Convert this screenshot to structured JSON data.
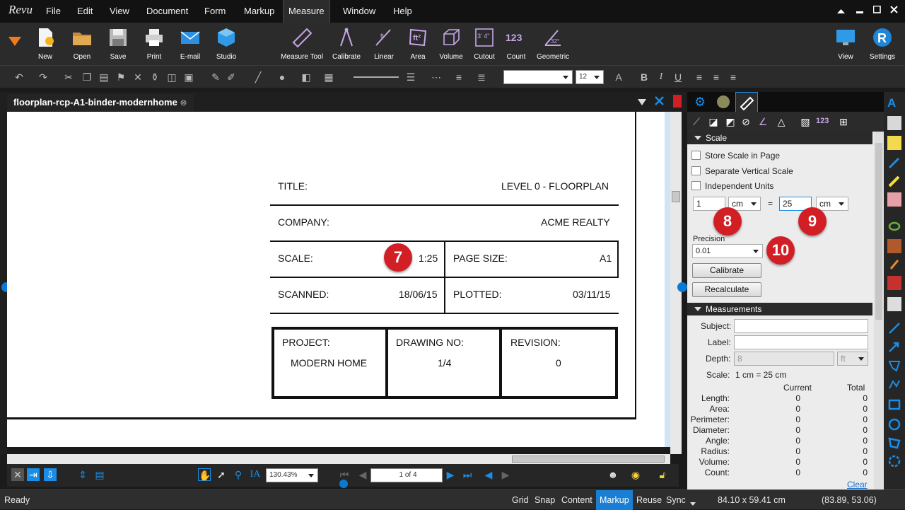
{
  "app": {
    "logo": "Revu"
  },
  "menu": {
    "items": [
      "File",
      "Edit",
      "View",
      "Document",
      "Form",
      "Markup",
      "Measure",
      "Window",
      "Help"
    ],
    "active": "Measure"
  },
  "ribbon": {
    "left": [
      "New",
      "Open",
      "Save",
      "Print",
      "E-mail",
      "Studio"
    ],
    "measure": [
      "Measure Tool",
      "Calibrate",
      "Linear",
      "Area",
      "Volume",
      "Cutout",
      "Count",
      "Geometric"
    ],
    "right": [
      "View",
      "Settings"
    ],
    "count_glyph": "123",
    "area_glyph": "ft²",
    "linear_glyph": "ft",
    "cutout_glyph": "3' 4\"",
    "geometric_glyph": "32°"
  },
  "toolbar": {
    "font_size": "12"
  },
  "document": {
    "tab_title": "floorplan-rcp-A1-binder-modernhome",
    "title_label": "TITLE:",
    "title_value": "LEVEL 0 - FLOORPLAN",
    "company_label": "COMPANY:",
    "company_value": "ACME REALTY",
    "scale_label": "SCALE:",
    "scale_value": "1:25",
    "pagesize_label": "PAGE SIZE:",
    "pagesize_value": "A1",
    "scanned_label": "SCANNED:",
    "scanned_value": "18/06/15",
    "plotted_label": "PLOTTED:",
    "plotted_value": "03/11/15",
    "project_label": "PROJECT:",
    "project_value": "MODERN HOME",
    "drawing_label": "DRAWING NO:",
    "drawing_value": "1/4",
    "revision_label": "REVISION:",
    "revision_value": "0"
  },
  "badges": {
    "b7": "7",
    "b8": "8",
    "b9": "9",
    "b10": "10"
  },
  "nav": {
    "zoom": "130.43%",
    "page": "1 of 4"
  },
  "status": {
    "ready": "Ready",
    "toggles": [
      "Grid",
      "Snap",
      "Content",
      "Markup",
      "Reuse",
      "Sync"
    ],
    "active_toggle": "Markup",
    "size": "84.10 x 59.41 cm",
    "coords": "(83.89, 53.06)"
  },
  "panel": {
    "scale_header": "Scale",
    "store_scale": "Store Scale in Page",
    "separate_vertical": "Separate Vertical Scale",
    "independent_units": "Independent Units",
    "scale_left_value": "1",
    "scale_left_unit": "cm",
    "equals": "=",
    "scale_right_value": "25",
    "scale_right_unit": "cm",
    "precision_label": "Precision",
    "precision_value": "0.01",
    "calibrate_btn": "Calibrate",
    "recalculate_btn": "Recalculate",
    "measurements_header": "Measurements",
    "subject_label": "Subject:",
    "label_label": "Label:",
    "depth_label": "Depth:",
    "depth_value": "8",
    "depth_unit": "ft",
    "scale_row_label": "Scale:",
    "scale_row_value": "1 cm = 25 cm",
    "current_col": "Current",
    "total_col": "Total",
    "rows": [
      {
        "name": "Length:",
        "current": "0",
        "total": "0"
      },
      {
        "name": "Area:",
        "current": "0",
        "total": "0"
      },
      {
        "name": "Perimeter:",
        "current": "0",
        "total": "0"
      },
      {
        "name": "Diameter:",
        "current": "0",
        "total": "0"
      },
      {
        "name": "Angle:",
        "current": "0",
        "total": "0"
      },
      {
        "name": "Radius:",
        "current": "0",
        "total": "0"
      },
      {
        "name": "Volume:",
        "current": "0",
        "total": "0"
      },
      {
        "name": "Count:",
        "current": "0",
        "total": "0"
      }
    ],
    "clear_link": "Clear"
  },
  "colors": {
    "accent": "#0a7ad6",
    "badge": "#d21f26",
    "menubar": "#121212"
  }
}
